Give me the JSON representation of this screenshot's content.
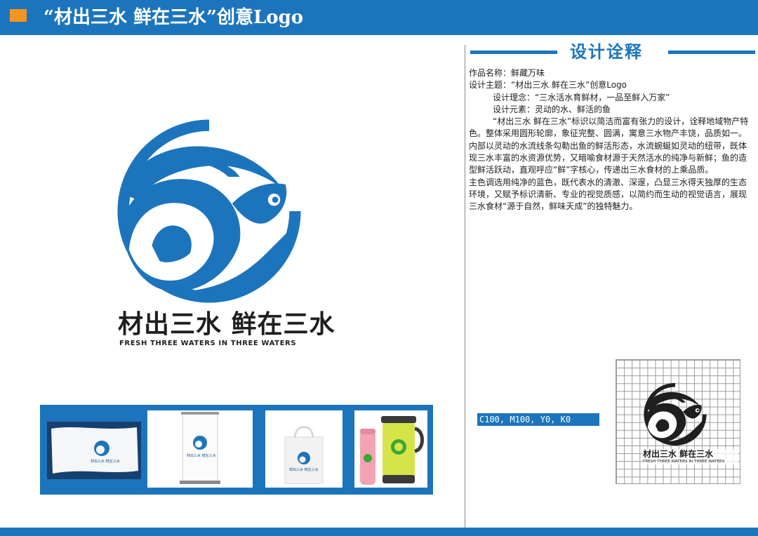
{
  "header": {
    "title": "“材出三水 鲜在三水”创意Logo",
    "accent_color": "#f7941d",
    "bar_color": "#1c75bc"
  },
  "brand": {
    "name_cn": "材出三水 鲜在三水",
    "name_en": "FRESH THREE WATERS IN THREE WATERS",
    "primary_color": "#1c75bc"
  },
  "mockups": {
    "items": [
      {
        "name": "flag-mockup",
        "icon": "flag"
      },
      {
        "name": "rollup-banner-mockup",
        "icon": "banner-stand"
      },
      {
        "name": "tote-bag-mockup",
        "icon": "tote-bag"
      },
      {
        "name": "bottles-mockup",
        "icon": "bottle"
      }
    ]
  },
  "description": {
    "section_title": "设计诠释",
    "work_name": "作品名称：鲜藏万味",
    "theme": "设计主题：“材出三水 鲜在三水”创意Logo",
    "concept": "设计理念：“三水活水育鲜材，一品至鲜入万家”",
    "elements": "设计元素：灵动的水、鲜活的鱼",
    "body": "“材出三水 鲜在三水”标识以简洁而富有张力的设计，诠释地域物产特色。整体采用圆形轮廓，象征完整、圆满，寓意三水物产丰饶，品质如一。内部以灵动的水流线条勾勒出鱼的鲜活形态，水流蜿蜒如灵动的纽带，既体现三水丰富的水资源优势，又暗喻食材源于天然活水的纯净与新鲜；鱼的造型鲜活跃动，直观呼应“鲜”字核心，传递出三水食材的上乘品质。",
    "color_note": "主色调选用纯净的蓝色，既代表水的清澈、深邃，凸显三水得天独厚的生态环境，又赋予标识清新、专业的视觉质感，以简约而生动的视觉语言，展现三水食材“源于自然，鲜味天成”的独特魅力。"
  },
  "color_spec": {
    "label": "C100, M100, Y0, K0"
  },
  "grid_version": {
    "name_cn": "材出三水 鲜在三水",
    "name_en": "FRESH THREE WATERS IN THREE WATERS",
    "color": "#1f1f1f"
  }
}
